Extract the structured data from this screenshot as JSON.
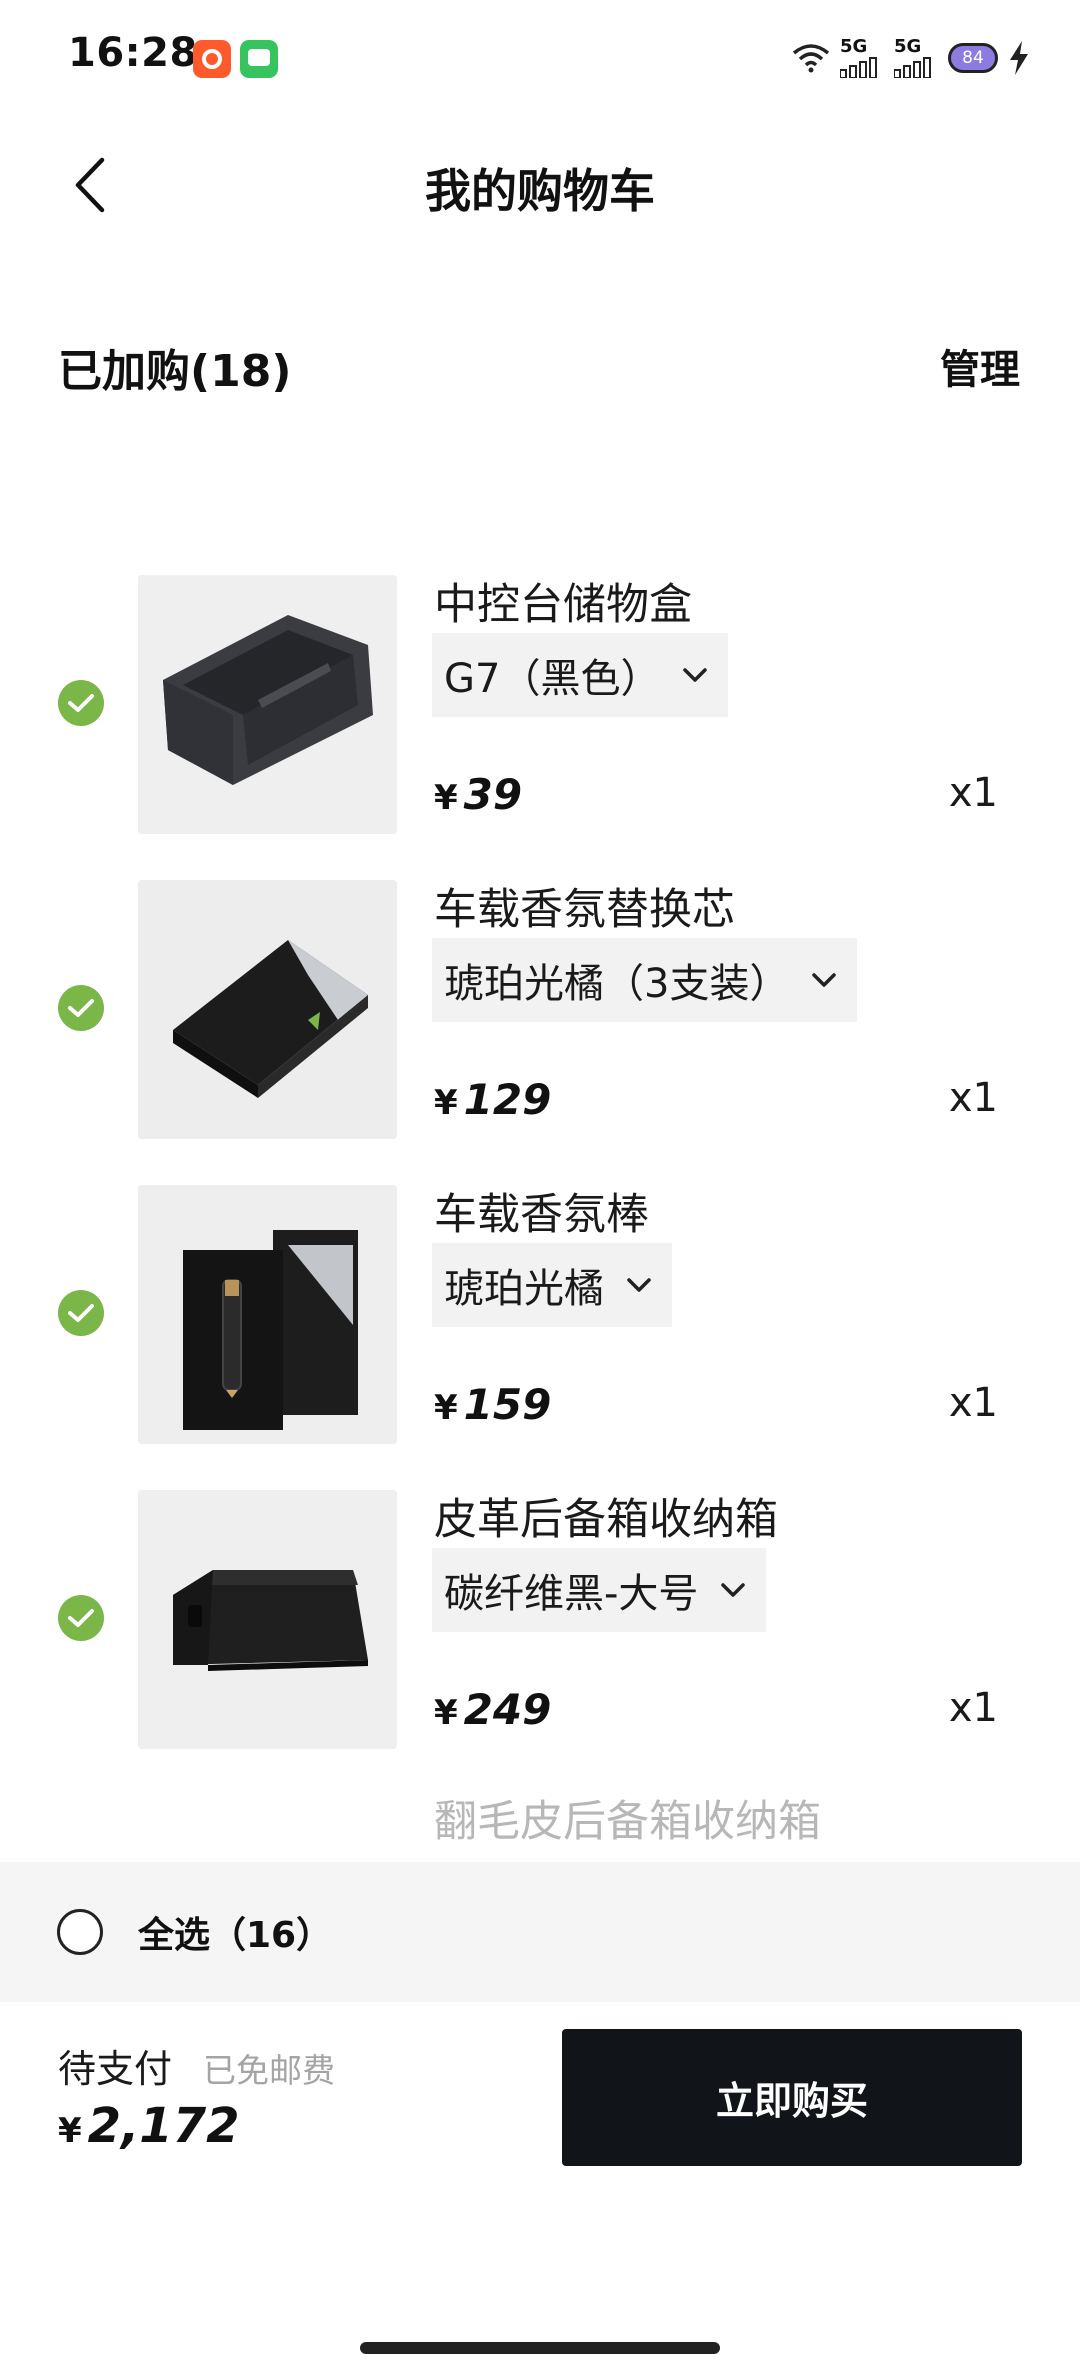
{
  "status_bar": {
    "time": "16:28",
    "network_1": "5G",
    "network_2": "5G",
    "battery": "84",
    "icons": [
      "taobao-app-icon",
      "messages-app-icon",
      "wifi-icon",
      "signal-icon",
      "charging-icon"
    ]
  },
  "header": {
    "title": "我的购物车",
    "back_icon": "chevron-left-icon"
  },
  "cart": {
    "count_label": "已加购(18)",
    "manage_label": "管理",
    "items": [
      {
        "name": "中控台储物盒",
        "spec": "G7（黑色）",
        "currency": "¥",
        "price": "39",
        "qty": "x1",
        "selected": true
      },
      {
        "name": "车载香氛替换芯",
        "spec": "琥珀光橘（3支装）",
        "currency": "¥",
        "price": "129",
        "qty": "x1",
        "selected": true
      },
      {
        "name": "车载香氛棒",
        "spec": "琥珀光橘",
        "currency": "¥",
        "price": "159",
        "qty": "x1",
        "selected": true
      },
      {
        "name": "皮革后备箱收纳箱",
        "spec": "碳纤维黑-大号",
        "currency": "¥",
        "price": "249",
        "qty": "x1",
        "selected": true
      }
    ],
    "partial_item_name": "翻毛皮后备箱收纳箱"
  },
  "select_all": {
    "label": "全选（16）",
    "checked": false
  },
  "checkout": {
    "pay_label": "待支付",
    "shipping_note": "已免邮费",
    "currency": "¥",
    "total": "2,172",
    "buy_label": "立即购买"
  },
  "colors": {
    "check_green": "#7ab648",
    "buy_button": "#111419",
    "select_bar_bg": "#f5f5f5",
    "spec_bg": "#f2f2f2"
  }
}
